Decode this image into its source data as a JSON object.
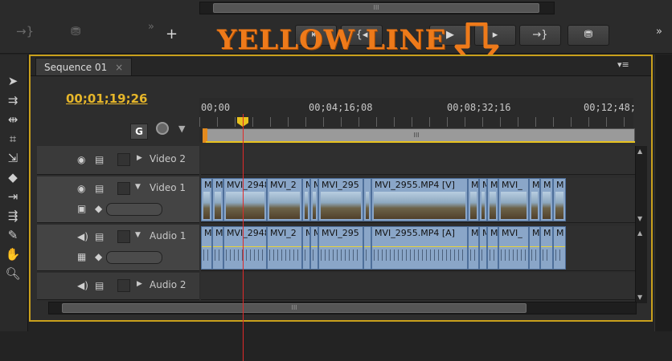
{
  "banner": {
    "text": "YELLOW LINE"
  },
  "toolbar": {
    "top_scroll_glyph": "III",
    "buttons": [
      {
        "name": "lift-button",
        "glyph": "⇤"
      },
      {
        "name": "step-back-button",
        "glyph": "{◂"
      },
      {
        "name": "play-button",
        "glyph": "▶"
      },
      {
        "name": "step-forward-button",
        "glyph": "▸"
      },
      {
        "name": "go-out-button",
        "glyph": "→}"
      },
      {
        "name": "export-frame-button",
        "glyph": "⛃"
      }
    ],
    "left_buttons": [
      {
        "name": "insert-button",
        "glyph": "→}"
      },
      {
        "name": "overwrite-button",
        "glyph": "⛃"
      }
    ],
    "overflow_glyph": "»",
    "add_glyph": "+"
  },
  "tab": {
    "label": "Sequence 01",
    "close": "×",
    "menu": "▾≡"
  },
  "timecode": "00;01;19;26",
  "ruler": {
    "labels": [
      "00;00",
      "00;04;16;08",
      "00;08;32;16",
      "00;12;48;"
    ],
    "workbar_glyph": "III"
  },
  "tracks": {
    "video2": {
      "label": "Video 2"
    },
    "video1": {
      "label": "Video 1"
    },
    "audio1": {
      "label": "Audio 1"
    },
    "audio2": {
      "label": "Audio 2"
    }
  },
  "video_clips": [
    "M",
    "M",
    "MVI_2948.",
    "MVI_2",
    "M",
    "M",
    "MVI_295",
    "",
    "MVI_2955.MP4 [V]",
    "M",
    "M",
    "M",
    "MVI_",
    "M",
    "M",
    "M"
  ],
  "audio_clips": [
    "M",
    "M",
    "MVI_2948.",
    "MVI_2",
    "M",
    "M",
    "MVI_295",
    "",
    "MVI_2955.MP4 [A]",
    "M",
    "M",
    "M",
    "MVI_",
    "M",
    "M",
    "M"
  ],
  "hscroll": {
    "glyph": "III"
  },
  "right_overflow": "»"
}
